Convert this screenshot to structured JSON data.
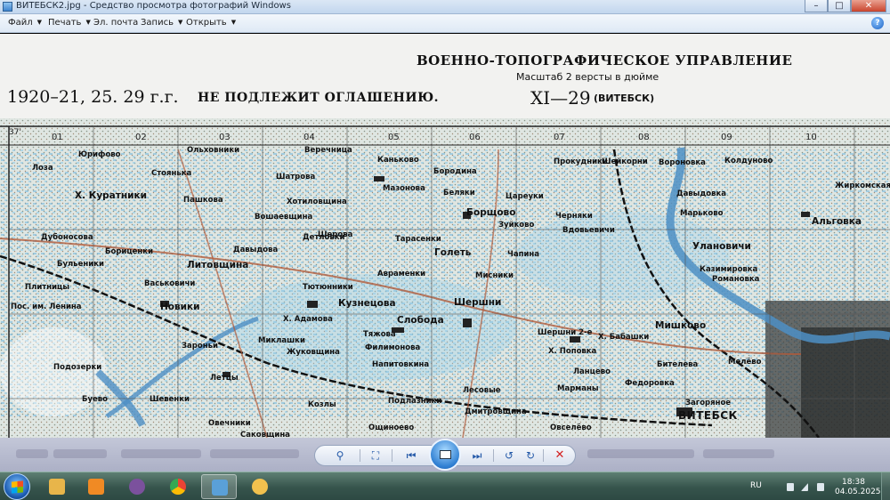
{
  "window": {
    "title": "ВИТЕБСК2.jpg - Средство просмотра фотографий Windows",
    "minimize": "–",
    "maximize": "□",
    "close": "✕"
  },
  "menu": {
    "items": [
      {
        "label": "Файл"
      },
      {
        "label": "Печать"
      },
      {
        "label": "Эл. почта"
      },
      {
        "label": "Запись"
      },
      {
        "label": "Открыть"
      }
    ],
    "dropdown_glyph": "▼",
    "help": "?"
  },
  "map": {
    "header_title": "ВОЕННО-ТОПОГРАФИЧЕСКОЕ УПРАВЛЕНИЕ",
    "scale": "Масштаб 2 версты в дюйме",
    "years": "1920–21, 25. 29 г.г.",
    "secrecy": "НЕ ПОДЛЕЖИТ ОГЛАШЕНИЮ.",
    "sheet": "XI—29",
    "sheet_city": "(ВИТЕБСК)",
    "corner_number": "37'",
    "column_numbers": [
      "01",
      "02",
      "03",
      "04",
      "05",
      "06",
      "07",
      "08",
      "09",
      "10"
    ],
    "places": [
      "Лоза",
      "Юрифово",
      "Ольховники",
      "Веречница",
      "Каньково",
      "Бородина",
      "Прокудники",
      "Шейкорни",
      "Вороновка",
      "Колдуново",
      "Х. Куратники",
      "Стоянька",
      "Пашкова",
      "Шатрова",
      "Хотиловщина",
      "Мазонова",
      "Беляки",
      "Цареуки",
      "Давыдовка",
      "Жиркомская",
      "Вошаевщина",
      "Шерова",
      "Борщово",
      "Черняки",
      "Марьково",
      "Альговка",
      "Дубоносова",
      "Бориценки",
      "Давыдова",
      "Детловки",
      "Тарасенки",
      "Зуйково",
      "Вдовьевичи",
      "Улановичи",
      "Бульеники",
      "Литовщина",
      "Голеть",
      "Чапина",
      "Казимировка",
      "Романовка",
      "Плитницы",
      "Васьковичи",
      "Тютюнники",
      "Авраменки",
      "Мисники",
      "Пос. им. Ленина",
      "Новики",
      "Х. Адамова",
      "Кузнецова",
      "Слобода",
      "Шершни",
      "Шершни 2-е",
      "Мишково",
      "Х. Бабашки",
      "Подозерки",
      "Зароньи",
      "Миклашки",
      "Жуковщина",
      "Филимонова",
      "Тяжова",
      "Х. Поповка",
      "Бителева",
      "Мелёво",
      "Летцы",
      "Напитовкина",
      "Ланцево",
      "Федоровка",
      "Буево",
      "Шевенки",
      "Козлы",
      "Подлазники",
      "Лесовые",
      "Марманы",
      "Загоряное",
      "Овечники",
      "Саковщина",
      "Ощиноево",
      "Дмитровщина",
      "Овселёво",
      "ВИТЕБСК"
    ]
  },
  "viewer_toolbar": {
    "buttons": [
      {
        "name": "zoom",
        "glyph": "⚲"
      },
      {
        "name": "fit",
        "glyph": "⛶"
      },
      {
        "name": "previous",
        "glyph": "⏮"
      },
      {
        "name": "slideshow",
        "glyph": ""
      },
      {
        "name": "next",
        "glyph": "⏭"
      },
      {
        "name": "rotate-left",
        "glyph": "↺"
      },
      {
        "name": "rotate-right",
        "glyph": "↻"
      },
      {
        "name": "delete",
        "glyph": "✕"
      }
    ]
  },
  "taskbar": {
    "language": "RU",
    "time": "18:38",
    "date": "04.05.2025",
    "colors": {
      "explorer": "#e8b54a",
      "media": "#f08a24",
      "viber": "#7b519d",
      "chrome": "#4285f4",
      "photoviewer": "#5aa0d8",
      "paint": "#f2c14e"
    }
  }
}
